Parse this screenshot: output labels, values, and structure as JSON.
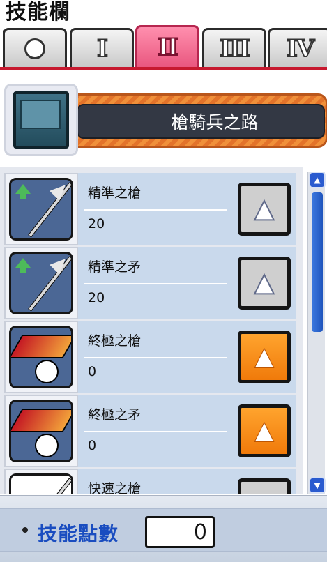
{
  "window": {
    "title": "技能欄"
  },
  "tabs": [
    {
      "id": "tab-0",
      "label": "",
      "icon": "circle-icon",
      "active": false
    },
    {
      "id": "tab-1",
      "label": "I",
      "active": false
    },
    {
      "id": "tab-2",
      "label": "II",
      "active": true
    },
    {
      "id": "tab-3",
      "label": "III",
      "active": false
    },
    {
      "id": "tab-4",
      "label": "IV",
      "active": false
    }
  ],
  "path": {
    "name": "槍騎兵之路",
    "icon": "skill-book-icon"
  },
  "skills": [
    {
      "name": "精準之槍",
      "level": "20",
      "icon": "spear-mastery-icon",
      "upgrade_enabled": false
    },
    {
      "name": "精準之矛",
      "level": "20",
      "icon": "polearm-mastery-icon",
      "upgrade_enabled": false
    },
    {
      "name": "終極之槍",
      "level": "0",
      "icon": "final-attack-spear-icon",
      "upgrade_enabled": true
    },
    {
      "name": "終極之矛",
      "level": "0",
      "icon": "final-attack-polearm-icon",
      "upgrade_enabled": true
    },
    {
      "name": "快速之槍",
      "level": "",
      "icon": "spear-booster-icon",
      "upgrade_enabled": false
    }
  ],
  "footer": {
    "label": "技能點數",
    "value": "0"
  },
  "colors": {
    "active_tab": "#e9577f",
    "tab_underline": "#c7192f",
    "path_plate": "#f0903a",
    "footer_label": "#1a4dc0",
    "upgrade_enabled": "#f07a0a"
  }
}
